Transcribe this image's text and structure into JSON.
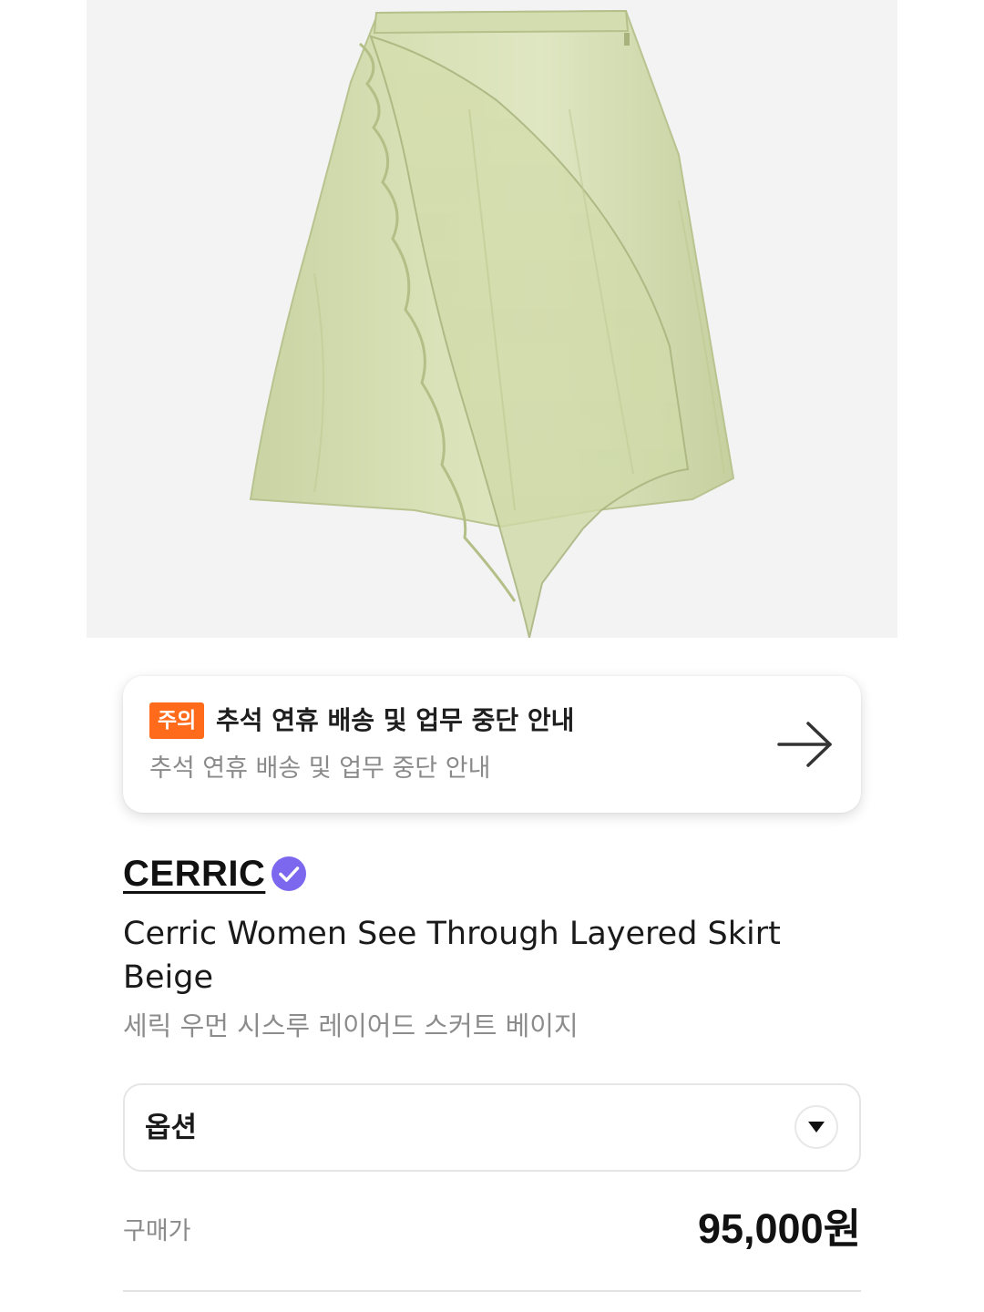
{
  "product_image": {
    "icon": "skirt-product-photo",
    "background_color": "#f3f3f3",
    "fabric_color": "#d2dcaf"
  },
  "notice": {
    "badge": "주의",
    "title": "추석 연휴 배송 및 업무 중단 안내",
    "subtitle": "추석 연휴 배송 및 업무 중단 안내",
    "badge_color": "#ff6b1a",
    "arrow_icon": "arrow-right-icon"
  },
  "brand": {
    "name": "CERRIC",
    "verified_icon": "verified-check-icon",
    "verified_color": "#7b68ee"
  },
  "product": {
    "name_en": "Cerric Women See Through Layered Skirt Beige",
    "name_ko": "세릭 우먼 시스루 레이어드 스커트 베이지"
  },
  "option": {
    "label": "옵션",
    "chevron_icon": "chevron-down-icon"
  },
  "price": {
    "label": "구매가",
    "value": "95,000원"
  }
}
